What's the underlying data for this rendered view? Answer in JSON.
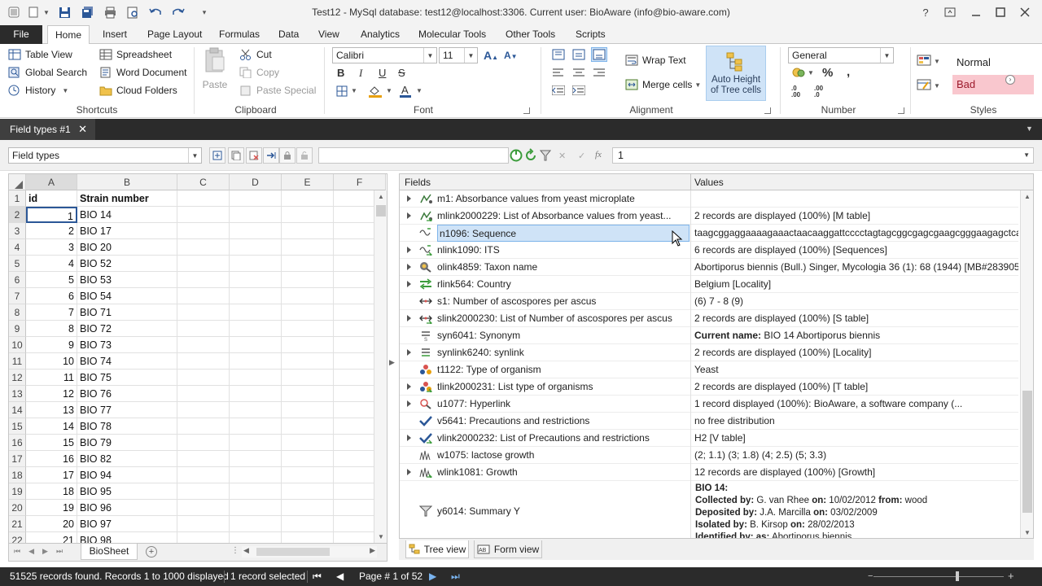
{
  "window": {
    "title": "Test12 - MySql database: test12@localhost:3306. Current user: BioAware (info@bio-aware.com)"
  },
  "ribbon_tabs": [
    "File",
    "Home",
    "Insert",
    "Page Layout",
    "Formulas",
    "Data",
    "View",
    "Analytics",
    "Molecular Tools",
    "Other Tools",
    "Scripts"
  ],
  "shortcuts": {
    "table_view": "Table View",
    "global_search": "Global Search",
    "history": "History",
    "spreadsheet": "Spreadsheet",
    "word_document": "Word Document",
    "cloud_folders": "Cloud Folders",
    "label": "Shortcuts"
  },
  "clipboard": {
    "paste": "Paste",
    "cut": "Cut",
    "copy": "Copy",
    "paste_special": "Paste Special",
    "label": "Clipboard"
  },
  "font": {
    "family": "Calibri",
    "size": "11",
    "label": "Font"
  },
  "alignment": {
    "wrap_text": "Wrap Text",
    "merge_cells": "Merge cells",
    "auto_height": "Auto Height",
    "auto_height2": "of Tree cells",
    "label": "Alignment"
  },
  "number": {
    "format": "General",
    "label": "Number"
  },
  "styles": {
    "normal": "Normal",
    "bad": "Bad",
    "label": "Styles"
  },
  "doc_tab": {
    "label": "Field types #1"
  },
  "toolbar": {
    "view_selector": "Field types",
    "search_value": "",
    "formula_value": "1"
  },
  "sheet": {
    "columns": [
      "A",
      "B",
      "C",
      "D",
      "E",
      "F"
    ],
    "header_row": {
      "id": "id",
      "strain": "Strain number"
    },
    "rows": [
      {
        "id": "1",
        "strain": "BIO 14"
      },
      {
        "id": "2",
        "strain": "BIO 17"
      },
      {
        "id": "3",
        "strain": "BIO 20"
      },
      {
        "id": "4",
        "strain": "BIO 52"
      },
      {
        "id": "5",
        "strain": "BIO 53"
      },
      {
        "id": "6",
        "strain": "BIO 54"
      },
      {
        "id": "7",
        "strain": "BIO 71"
      },
      {
        "id": "8",
        "strain": "BIO 72"
      },
      {
        "id": "9",
        "strain": "BIO 73"
      },
      {
        "id": "10",
        "strain": "BIO 74"
      },
      {
        "id": "11",
        "strain": "BIO 75"
      },
      {
        "id": "12",
        "strain": "BIO 76"
      },
      {
        "id": "13",
        "strain": "BIO 77"
      },
      {
        "id": "14",
        "strain": "BIO 78"
      },
      {
        "id": "15",
        "strain": "BIO 79"
      },
      {
        "id": "16",
        "strain": "BIO 82"
      },
      {
        "id": "17",
        "strain": "BIO 94"
      },
      {
        "id": "18",
        "strain": "BIO 95"
      },
      {
        "id": "19",
        "strain": "BIO 96"
      },
      {
        "id": "20",
        "strain": "BIO 97"
      },
      {
        "id": "21",
        "strain": "BIO 98"
      }
    ],
    "sheet_tab": "BioSheet"
  },
  "tree": {
    "col_fields": "Fields",
    "col_values": "Values",
    "rows": [
      {
        "name": "m1: Absorbance values from yeast microplate",
        "value": "",
        "expand": true,
        "icon": "absorbance-icon"
      },
      {
        "name": "mlink2000229: List of Absorbance values from yeast...",
        "value": "2 records are displayed (100%) [M table]",
        "expand": true,
        "icon": "absorbance-link-icon"
      },
      {
        "name": "n1096: Sequence",
        "value": "taagcggaggaaaagaaactaacaaggattcccctagtagcggcgagcgaagcgggaagagctca...",
        "expand": false,
        "icon": "sequence-icon",
        "selected": true
      },
      {
        "name": "nlink1090: ITS",
        "value": "6 records are displayed (100%) [Sequences]",
        "expand": true,
        "icon": "sequence-link-icon"
      },
      {
        "name": "olink4859: Taxon name",
        "value": "Abortiporus biennis (Bull.) Singer, Mycologia 36 (1): 68 (1944) [MB#283905]...",
        "expand": true,
        "icon": "taxon-icon"
      },
      {
        "name": "rlink564: Country",
        "value": "Belgium [Locality]",
        "expand": true,
        "icon": "country-icon"
      },
      {
        "name": "s1: Number of ascospores per ascus",
        "value": "(6) 7 - 8 (9)",
        "expand": false,
        "icon": "range-icon"
      },
      {
        "name": "slink2000230: List of Number of ascospores per ascus",
        "value": "2 records are displayed (100%) [S table]",
        "expand": true,
        "icon": "range-link-icon"
      },
      {
        "name": "syn6041: Synonym",
        "value_label": "Current name:",
        "value": "BIO 14 Abortiporus biennis",
        "expand": false,
        "icon": "synonym-icon"
      },
      {
        "name": "synlink6240: synlink",
        "value": "2 records are displayed (100%) [Locality]",
        "expand": true,
        "icon": "synlink-icon"
      },
      {
        "name": "t1122: Type of organism",
        "value": "Yeast",
        "expand": false,
        "icon": "organism-icon"
      },
      {
        "name": "tlink2000231: List type of organisms",
        "value": "2 records are displayed (100%) [T table]",
        "expand": true,
        "icon": "organism-link-icon"
      },
      {
        "name": "u1077: Hyperlink",
        "value": "1 record displayed (100%): BioAware, a software company (...",
        "expand": true,
        "icon": "hyperlink-icon"
      },
      {
        "name": "v5641: Precautions and restrictions",
        "value": "no free distribution",
        "expand": false,
        "icon": "check-icon"
      },
      {
        "name": "vlink2000232: List of Precautions and restrictions",
        "value": "H2 [V table]",
        "expand": true,
        "icon": "check-link-icon"
      },
      {
        "name": "w1075: lactose growth",
        "value": "(2; 1.1) (3; 1.8) (4; 2.5) (5; 3.3)",
        "expand": false,
        "icon": "growth-icon"
      },
      {
        "name": "wlink1081: Growth",
        "value": "12 records are displayed (100%) [Growth]",
        "expand": true,
        "icon": "growth-link-icon"
      }
    ],
    "summary": {
      "name": "y6014: Summary Y",
      "strain": "BIO 14:",
      "collected_by_label": "Collected by:",
      "collected_by": "G. van Rhee",
      "on_label": "on:",
      "collected_on": "10/02/2012",
      "from_label": "from:",
      "collected_from": "wood",
      "deposited_by_label": "Deposited by:",
      "deposited_by": "J.A. Marcilla",
      "deposited_on": "03/02/2009",
      "isolated_by_label": "Isolated by:",
      "isolated_by": "B. Kirsop",
      "isolated_on": "28/02/2013",
      "identified_by_label": "Identified by:",
      "identified_as_label": "as:",
      "identified_as": "Abortiporus biennis"
    },
    "tree_view": "Tree view",
    "form_view": "Form view"
  },
  "status": {
    "records": "51525 records found. Records 1 to 1000 displayed",
    "selected": "1 record selected",
    "page": "Page # 1 of 52"
  }
}
